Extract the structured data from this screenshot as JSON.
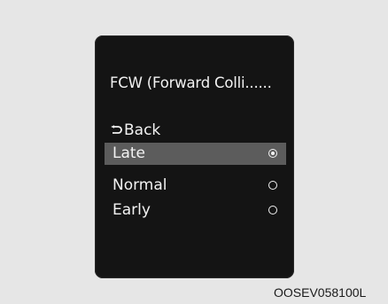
{
  "menu": {
    "title": "FCW (Forward Colli......",
    "back_label": "Back",
    "options": [
      {
        "label": "Late",
        "selected": true
      },
      {
        "label": "Normal",
        "selected": false
      },
      {
        "label": "Early",
        "selected": false
      }
    ]
  },
  "image_code": "OOSEV058100L",
  "colors": {
    "screen": "#141414",
    "highlight": "#5c5c5c",
    "text": "#f2f2f2",
    "background": "#e6e6e6"
  },
  "icons": {
    "back": "return-arrow-icon",
    "selected": "radio-checked-icon",
    "unselected": "radio-unchecked-icon"
  }
}
